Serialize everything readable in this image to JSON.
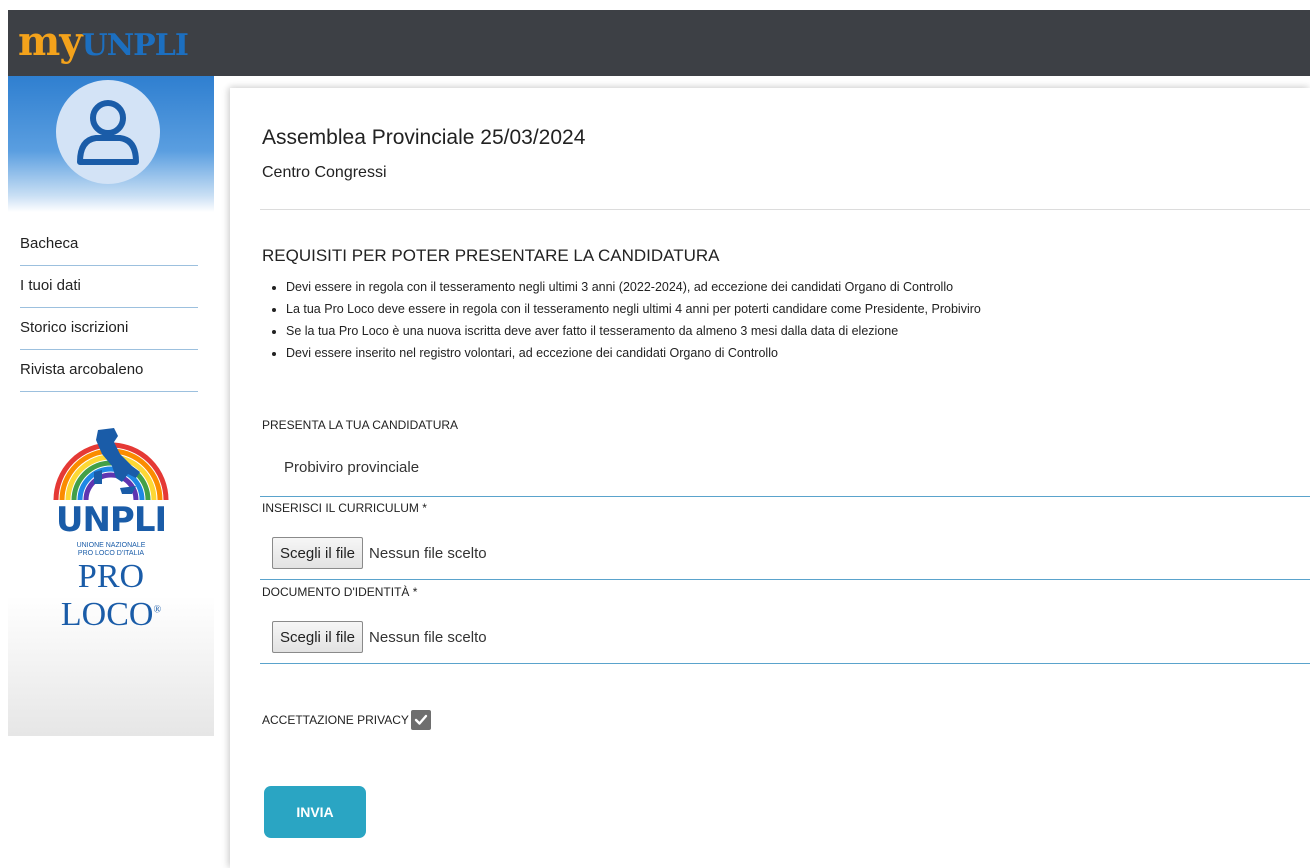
{
  "header": {
    "logo_my": "my",
    "logo_unpli": "UNPLI"
  },
  "sidebar": {
    "items": [
      {
        "label": "Bacheca"
      },
      {
        "label": "I tuoi dati"
      },
      {
        "label": "Storico iscrizioni"
      },
      {
        "label": "Rivista arcobaleno"
      }
    ],
    "brand": {
      "name": "UNPLI",
      "sub_line1": "UNIONE NAZIONALE",
      "sub_line2": "PRO LOCO D'ITALIA",
      "proloco": "PRO LOCO",
      "registered": "®"
    }
  },
  "main": {
    "title": "Assemblea Provinciale 25/03/2024",
    "subtitle": "Centro Congressi",
    "requirements_title": "REQUISITI PER POTER PRESENTARE LA CANDIDATURA",
    "requirements": [
      "Devi essere in regola con il tesseramento negli ultimi 3 anni (2022-2024), ad eccezione dei candidati Organo di Controllo",
      "La tua Pro Loco deve essere in regola con il tesseramento negli ultimi 4 anni per poterti candidare come Presidente, Probiviro",
      "Se la tua Pro Loco è una nuova iscritta deve aver fatto il tesseramento da almeno 3 mesi dalla data di elezione",
      "Devi essere inserito nel registro volontari, ad eccezione dei candidati Organo di Controllo"
    ],
    "candidature_label": "PRESENTA LA TUA CANDIDATURA",
    "candidature_value": "Probiviro provinciale",
    "cv_label": "INSERISCI IL CURRICULUM *",
    "id_label": "DOCUMENTO D'IDENTITÀ *",
    "file_button": "Scegli il file",
    "file_status": "Nessun file scelto",
    "privacy_label": "ACCETTAZIONE PRIVACY",
    "privacy_checked": true,
    "submit_label": "INVIA"
  },
  "colors": {
    "topbar": "#3d4045",
    "logo_orange": "#f3a21b",
    "logo_blue": "#1c6fc0",
    "accent": "#2aa5c3",
    "divider_blue": "#5aa3cc"
  }
}
